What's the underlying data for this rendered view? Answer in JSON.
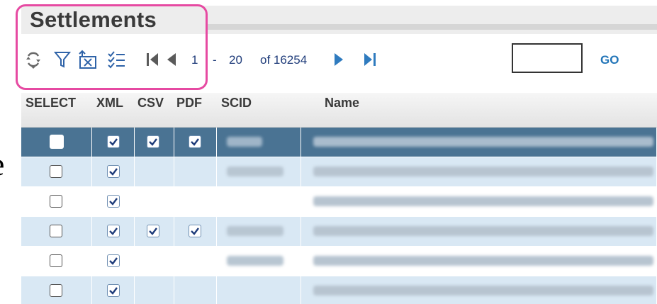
{
  "page": {
    "stray_char": "e"
  },
  "header": {
    "title": "Settlements"
  },
  "toolbar": {
    "icons": [
      "refresh-icon",
      "filter-icon",
      "export-excel-icon",
      "column-chooser-icon",
      "first-page-icon",
      "prev-page-icon",
      "next-page-icon",
      "last-page-icon"
    ],
    "page_start": "1",
    "dash": "-",
    "page_end": "20",
    "total": "of 16254",
    "page_input_value": "",
    "go_label": "GO"
  },
  "grid": {
    "columns": [
      "SELECT",
      "XML",
      "CSV",
      "PDF",
      "SCID",
      "Name"
    ],
    "rows": [
      {
        "select": false,
        "xml": true,
        "csv": true,
        "pdf": true,
        "selected": true
      },
      {
        "select": false,
        "xml": true,
        "csv": false,
        "pdf": false,
        "selected": false
      },
      {
        "select": false,
        "xml": true,
        "csv": false,
        "pdf": false,
        "selected": false
      },
      {
        "select": false,
        "xml": true,
        "csv": true,
        "pdf": true,
        "selected": false
      },
      {
        "select": false,
        "xml": true,
        "csv": false,
        "pdf": false,
        "selected": false
      },
      {
        "select": false,
        "xml": true,
        "csv": false,
        "pdf": false,
        "selected": false
      }
    ]
  },
  "colors": {
    "highlight": "#e64aa2",
    "selected_row": "#4a7393",
    "alt_row": "#d9e8f4",
    "go": "#2275b8",
    "pager_icon": "#2f7bbf"
  }
}
